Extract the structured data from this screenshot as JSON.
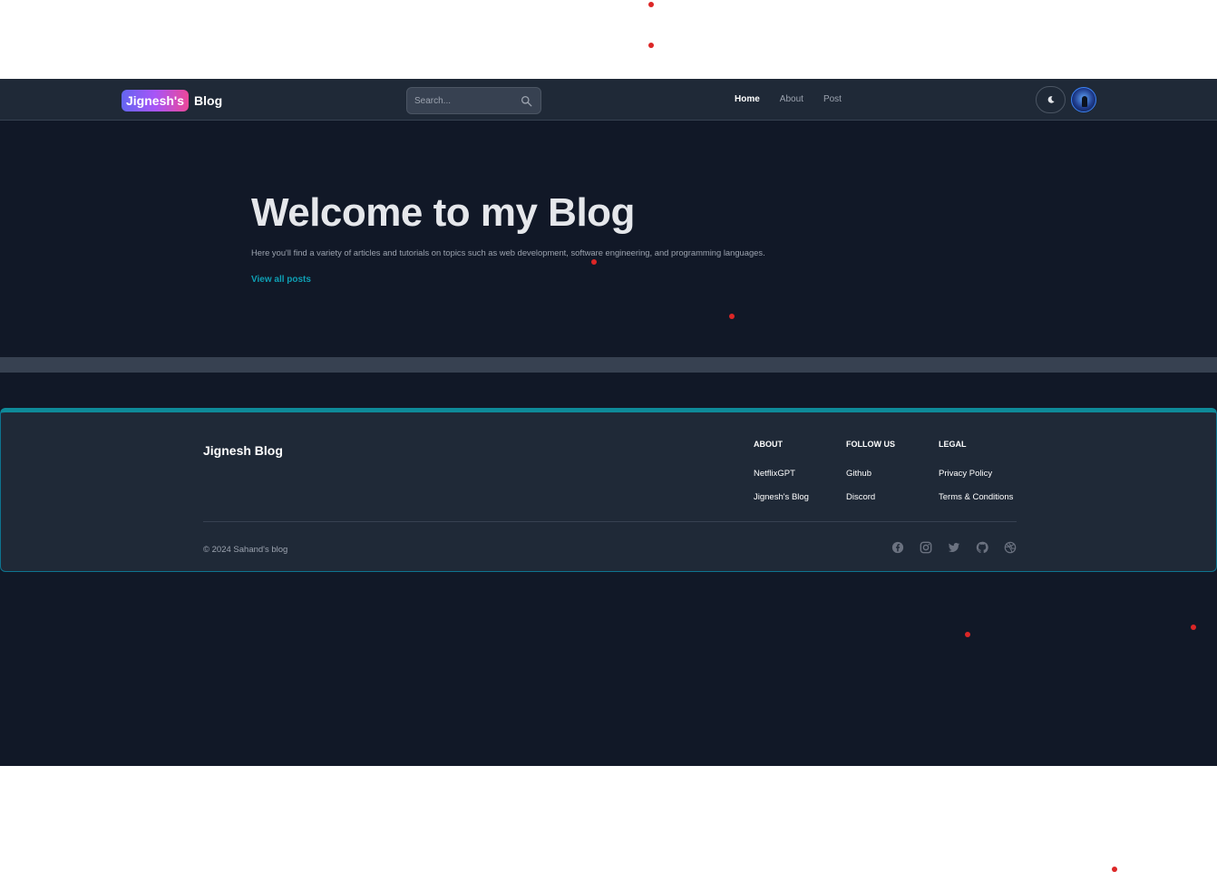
{
  "header": {
    "logo_badge": "Jignesh's",
    "logo_text": "Blog",
    "search_placeholder": "Search...",
    "nav": [
      {
        "label": "Home",
        "active": true
      },
      {
        "label": "About",
        "active": false
      },
      {
        "label": "Post",
        "active": false
      }
    ],
    "theme_icon": "moon-icon",
    "avatar_icon": "avatar"
  },
  "hero": {
    "title": "Welcome to my Blog",
    "subtitle": "Here you'll find a variety of articles and tutorials on topics such as web development, software engineering, and programming languages.",
    "link": "View all posts"
  },
  "footer": {
    "brand": "Jignesh Blog",
    "columns": [
      {
        "heading": "ABOUT",
        "links": [
          "NetflixGPT",
          "Jignesh's Blog"
        ]
      },
      {
        "heading": "FOLLOW US",
        "links": [
          "Github",
          "Discord"
        ]
      },
      {
        "heading": "LEGAL",
        "links": [
          "Privacy Policy",
          "Terms & Conditions"
        ]
      }
    ],
    "copyright": "© 2024 Sahand's blog",
    "social_icons": [
      "facebook-icon",
      "instagram-icon",
      "twitter-icon",
      "github-icon",
      "dribbble-icon"
    ]
  },
  "colors": {
    "background": "#111827",
    "surface": "#1f2937",
    "accent": "#0e9fb4",
    "marker": "#dc2626"
  }
}
